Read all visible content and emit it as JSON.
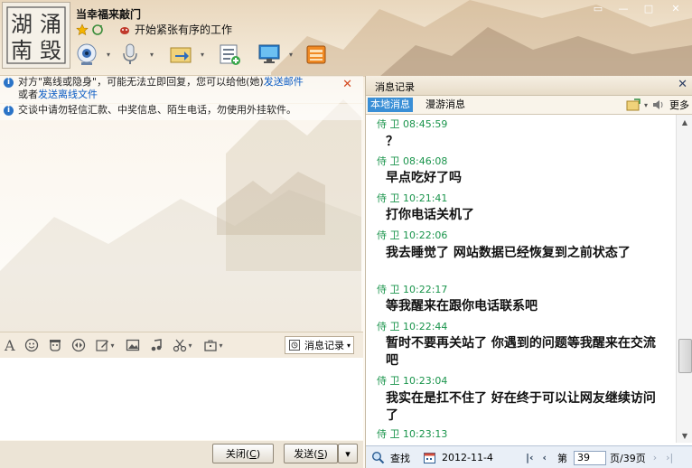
{
  "contact": {
    "name": "当幸福来敲门",
    "signature": "开始紧张有序的工作"
  },
  "avatar": {
    "chars": [
      "湖",
      "涌",
      "南",
      "毁"
    ]
  },
  "window_controls": {
    "skin": "▭",
    "minimize": "—",
    "maximize": "□",
    "close": "✕"
  },
  "toolbar": {
    "icons": [
      "video-call-icon",
      "voice-call-icon",
      "send-file-icon",
      "app-list-icon",
      "remote-desktop-icon",
      "app-box-icon"
    ]
  },
  "notices": [
    {
      "text1": "对方\"离线或隐身\"，可能无法立即回复，您可以给他(她)",
      "link1": "发送邮件",
      "text2": "或者",
      "link2": "发送离线文件"
    },
    {
      "text": "交谈中请勿轻信汇款、中奖信息、陌生电话，勿使用外挂软件。"
    }
  ],
  "compose": {
    "history_button": "消息记录",
    "close_button": {
      "label": "关闭",
      "hotkey": "C"
    },
    "send_button": {
      "label": "发送",
      "hotkey": "S"
    }
  },
  "history_panel": {
    "title": "消息记录",
    "tabs": [
      "本地消息",
      "漫游消息"
    ],
    "more": "更多",
    "messages": [
      {
        "sender": "侍 卫",
        "time": "08:45:59",
        "text": "？"
      },
      {
        "sender": "侍 卫",
        "time": "08:46:08",
        "text": "早点吃好了吗"
      },
      {
        "sender": "侍 卫",
        "time": "10:21:41",
        "text": "打你电话关机了"
      },
      {
        "sender": "侍 卫",
        "time": "10:22:06",
        "text": "我去睡觉了 网站数据已经恢复到之前状态了"
      },
      {
        "sender": "侍 卫",
        "time": "10:22:17",
        "text": "等我醒来在跟你电话联系吧"
      },
      {
        "sender": "侍 卫",
        "time": "10:22:44",
        "text": "暂时不要再关站了 你遇到的问题等我醒来在交流吧"
      },
      {
        "sender": "侍 卫",
        "time": "10:23:04",
        "text": "我实在是扛不住了 好在终于可以让网友继续访问了"
      },
      {
        "sender": "侍 卫",
        "time": "10:23:13",
        "text": ""
      }
    ],
    "footer": {
      "search": "查找",
      "date": "2012-11-4",
      "page_prefix": "第",
      "page": "39",
      "page_suffix": "页/39页"
    }
  },
  "colors": {
    "timestamp": "#19944b",
    "link": "#0a5bc4",
    "tab_active": "#3a8fd6"
  }
}
